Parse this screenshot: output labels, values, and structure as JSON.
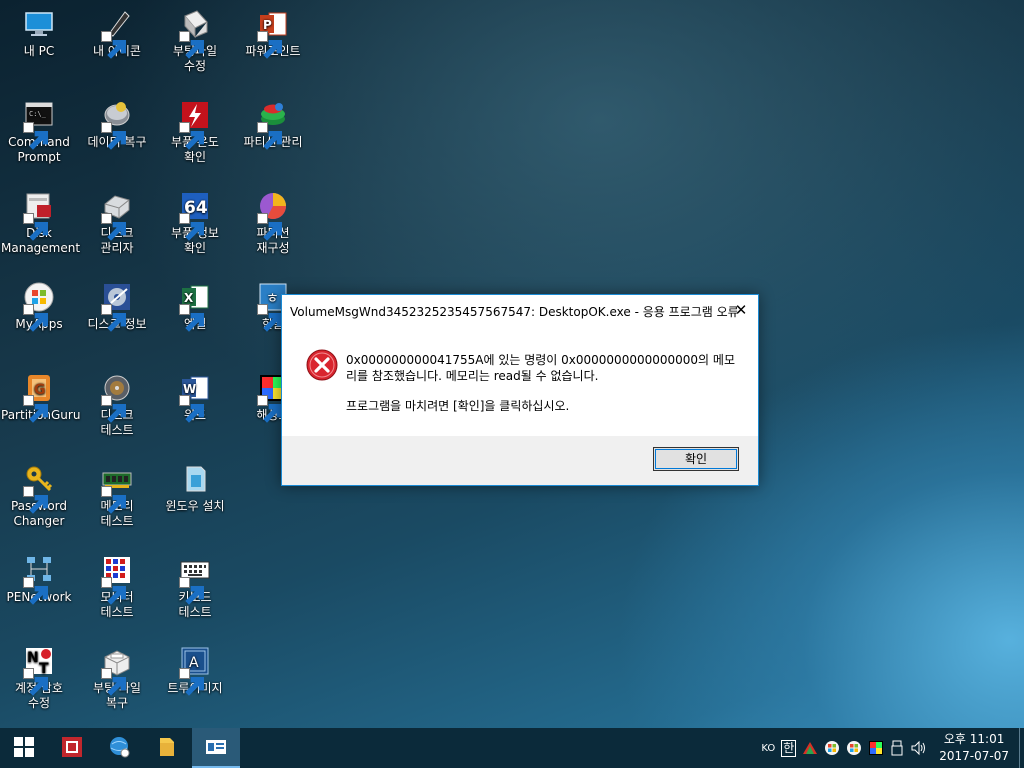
{
  "desktop": {
    "icons": [
      {
        "label": "내 PC"
      },
      {
        "label": "내 아이콘"
      },
      {
        "label": "부팅파일\n수정"
      },
      {
        "label": "파워포인트"
      },
      {
        "label": "Command\nPrompt"
      },
      {
        "label": "데이터 복구"
      },
      {
        "label": "부품 온도\n확인"
      },
      {
        "label": "파티션 관리"
      },
      {
        "label": "Disk\nManagement"
      },
      {
        "label": "디스크\n관리자"
      },
      {
        "label": "부품 정보\n확인"
      },
      {
        "label": "파티션\n재구성"
      },
      {
        "label": "MyApps"
      },
      {
        "label": "디스크 정보"
      },
      {
        "label": "엑셀"
      },
      {
        "label": "한글"
      },
      {
        "label": "PartitionGuru"
      },
      {
        "label": "디스크\n테스트"
      },
      {
        "label": "워드"
      },
      {
        "label": "해상도"
      },
      {
        "label": "Password\nChanger"
      },
      {
        "label": "메모리\n테스트"
      },
      {
        "label": "윈도우 설치"
      },
      {
        "label": "PENetwork"
      },
      {
        "label": "모니터\n테스트"
      },
      {
        "label": "키보드\n테스트"
      },
      {
        "label": "계정 암호\n수정"
      },
      {
        "label": "부팅 파일\n복구"
      },
      {
        "label": "트루이미지"
      }
    ]
  },
  "dialog": {
    "title": "VolumeMsgWnd3452325235457567547: DesktopOK.exe - 응용 프로그램 오류",
    "message": "0x000000000041755A에 있는 명령이 0x0000000000000000의 메모\n리를 참조했습니다. 메모리는 read될 수 없습니다.",
    "message2": "프로그램을 마치려면 [확인]을 클릭하십시오.",
    "ok_label": "확인",
    "close_label": "✕"
  },
  "taskbar": {
    "lang": "KO",
    "ime": "한",
    "clock_time": "오후 11:01",
    "clock_date": "2017-07-07"
  },
  "colors": {
    "accent": "#0078d7",
    "error_red": "#d9252e",
    "taskbar_bg": "#0b2a3a"
  }
}
